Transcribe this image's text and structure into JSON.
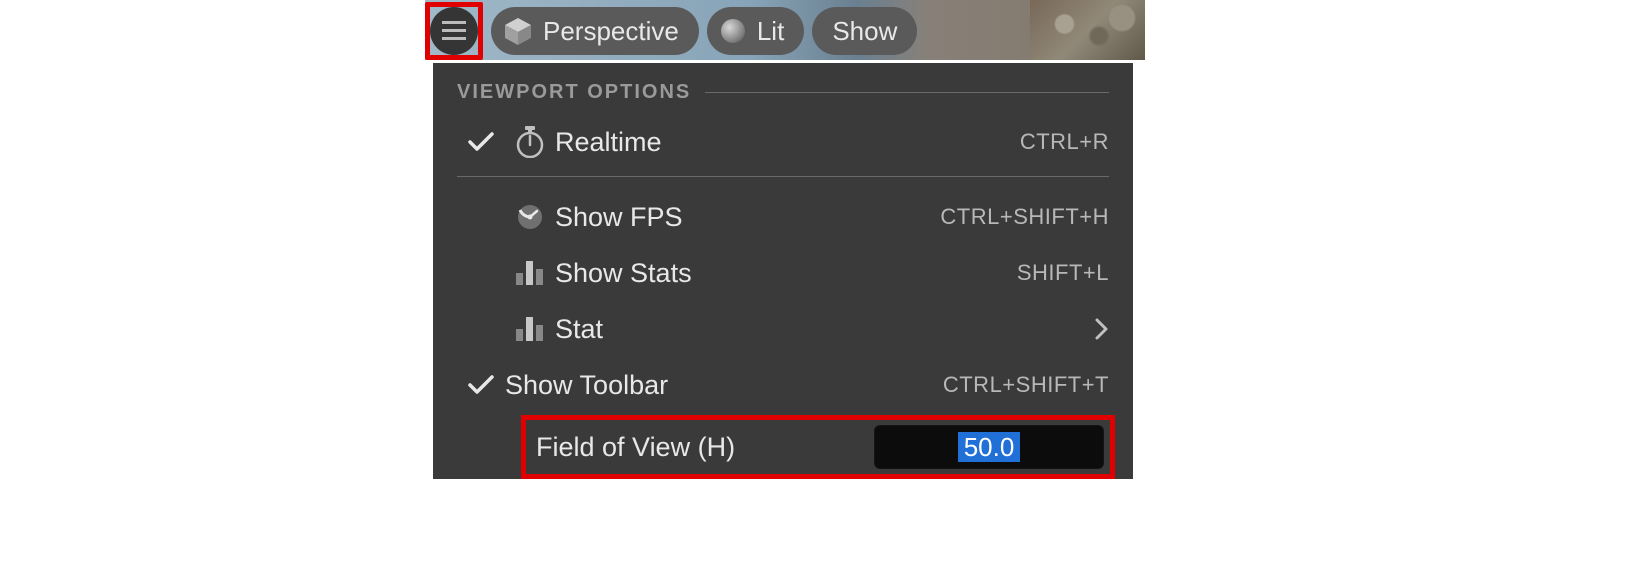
{
  "toolbar": {
    "perspective_label": "Perspective",
    "lit_label": "Lit",
    "show_label": "Show"
  },
  "menu": {
    "section_title": "VIEWPORT OPTIONS",
    "items": {
      "realtime": {
        "label": "Realtime",
        "shortcut": "CTRL+R",
        "checked": true
      },
      "show_fps": {
        "label": "Show FPS",
        "shortcut": "CTRL+SHIFT+H",
        "checked": false
      },
      "show_stats": {
        "label": "Show Stats",
        "shortcut": "SHIFT+L",
        "checked": false
      },
      "stat": {
        "label": "Stat",
        "has_submenu": true
      },
      "show_toolbar": {
        "label": "Show Toolbar",
        "shortcut": "CTRL+SHIFT+T",
        "checked": true
      },
      "fov": {
        "label": "Field of View (H)",
        "value": "50.0"
      }
    }
  }
}
